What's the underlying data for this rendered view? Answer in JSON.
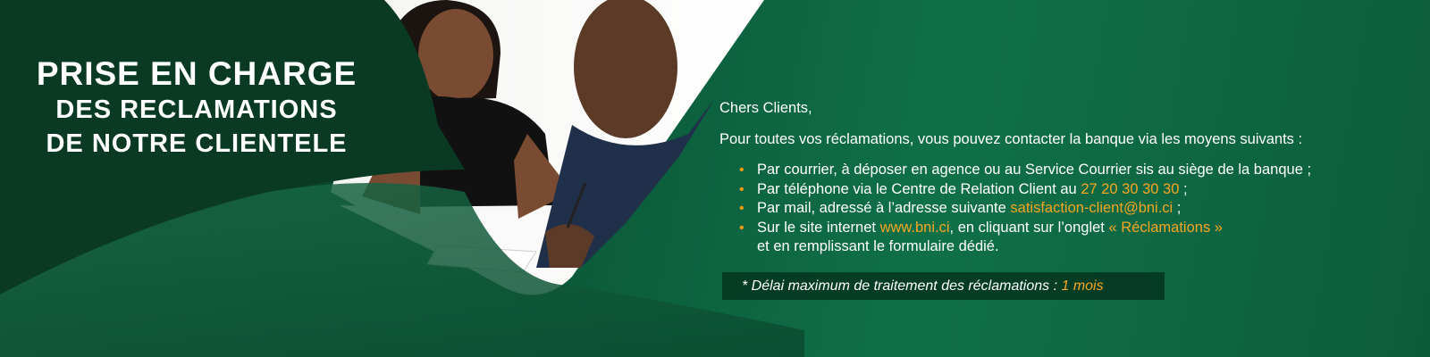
{
  "colors": {
    "dark_green": "#07331f",
    "mid_green": "#0b5a3a",
    "accent_orange": "#f5a623"
  },
  "headline": {
    "line1": "PRISE EN CHARGE",
    "line2": "DES RECLAMATIONS",
    "line3": "DE NOTRE CLIENTELE"
  },
  "photo": {
    "icon": "customer-service-meeting-photo"
  },
  "content": {
    "greeting": "Chers Clients,",
    "intro": "Pour toutes vos réclamations, vous pouvez contacter la banque via les moyens suivants :",
    "means": [
      {
        "text": "Par courrier, à déposer en agence ou au Service Courrier sis au siège de la banque ;"
      },
      {
        "text": "Par téléphone via le Centre de Relation Client au ",
        "highlight": "27 20 30 30 30",
        "suffix": " ;"
      },
      {
        "text": "Par mail, adressé à l’adresse suivante ",
        "highlight": "satisfaction-client@bni.ci",
        "suffix": " ;"
      },
      {
        "text": "Sur le site internet ",
        "highlight": "www.bni.ci",
        "middle": ", en cliquant sur l’onglet ",
        "highlight2": "« Réclamations »",
        "line2": "et en remplissant le formulaire dédié."
      }
    ]
  },
  "delay_note": {
    "text": "* Délai maximum de traitement des réclamations : ",
    "value": "1 mois"
  }
}
